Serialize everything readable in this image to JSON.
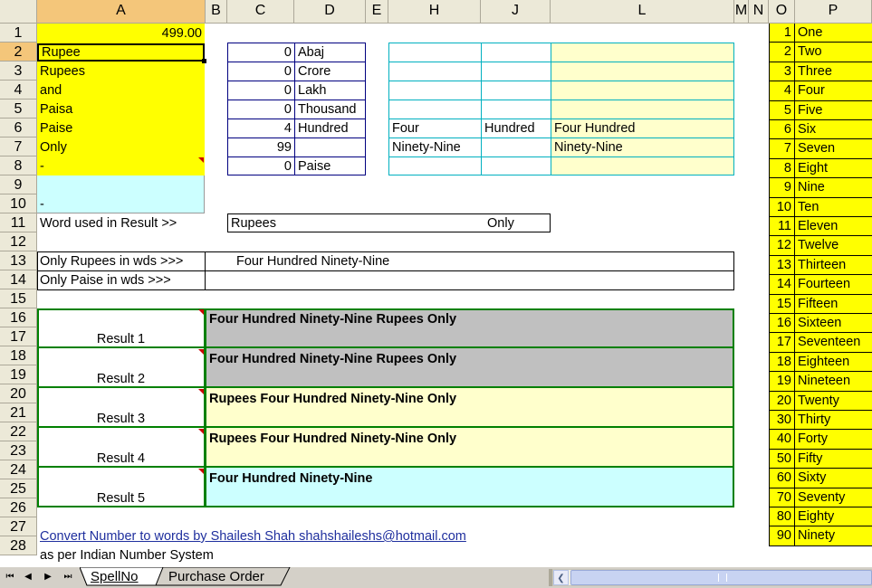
{
  "columns": [
    "A",
    "B",
    "C",
    "D",
    "E",
    "H",
    "J",
    "L",
    "M",
    "N",
    "O",
    "P"
  ],
  "rows": [
    "1",
    "2",
    "3",
    "4",
    "5",
    "6",
    "7",
    "8",
    "9",
    "10",
    "11",
    "12",
    "13",
    "14",
    "15",
    "16",
    "17",
    "18",
    "19",
    "20",
    "21",
    "22",
    "23",
    "24",
    "25",
    "26",
    "27",
    "28"
  ],
  "colA": {
    "a1": "499.00",
    "a2": "Rupee",
    "a3": "Rupees",
    "a4": "and",
    "a5": "Paisa",
    "a6": "Paise",
    "a7": "Only",
    "a8": "-",
    "a10": "-"
  },
  "place_values": [
    {
      "num": "0",
      "label": "Abaj"
    },
    {
      "num": "0",
      "label": "Crore"
    },
    {
      "num": "0",
      "label": "Lakh"
    },
    {
      "num": "0",
      "label": "Thousand"
    },
    {
      "num": "4",
      "label": "Hundred"
    },
    {
      "num": "99",
      "label": ""
    },
    {
      "num": "0",
      "label": "Paise"
    }
  ],
  "words_table": [
    {
      "h": "",
      "j": "",
      "l": ""
    },
    {
      "h": "",
      "j": "",
      "l": ""
    },
    {
      "h": "",
      "j": "",
      "l": ""
    },
    {
      "h": "",
      "j": "",
      "l": ""
    },
    {
      "h": "Four",
      "j": "Hundred",
      "l": "Four Hundred"
    },
    {
      "h": "Ninety-Nine",
      "j": "",
      "l": "Ninety-Nine"
    },
    {
      "h": "",
      "j": "",
      "l": ""
    }
  ],
  "word_used": {
    "label": "Word used in Result >>",
    "prefix": "Rupees",
    "suffix": "Only"
  },
  "only_rupees": {
    "label": "Only Rupees in wds  >>>",
    "value": "Four Hundred Ninety-Nine"
  },
  "only_paise": {
    "label": "Only Paise in wds   >>>",
    "value": ""
  },
  "results": [
    {
      "label": "Result 1",
      "value": "Four Hundred Ninety-Nine Rupees Only"
    },
    {
      "label": "Result 2",
      "value": "Four Hundred Ninety-Nine Rupees Only"
    },
    {
      "label": "Result 3",
      "value": "Rupees Four Hundred Ninety-Nine Only"
    },
    {
      "label": "Result 4",
      "value": "Rupees Four Hundred Ninety-Nine Only"
    },
    {
      "label": "Result 5",
      "value": "Four Hundred Ninety-Nine"
    }
  ],
  "footer": {
    "link": "Convert Number to words by Shailesh Shah shahshaileshs@hotmail.com",
    "note": "as per Indian Number System"
  },
  "lookup": [
    {
      "n": "1",
      "w": "One"
    },
    {
      "n": "2",
      "w": "Two"
    },
    {
      "n": "3",
      "w": "Three"
    },
    {
      "n": "4",
      "w": "Four"
    },
    {
      "n": "5",
      "w": "Five"
    },
    {
      "n": "6",
      "w": "Six"
    },
    {
      "n": "7",
      "w": "Seven"
    },
    {
      "n": "8",
      "w": "Eight"
    },
    {
      "n": "9",
      "w": "Nine"
    },
    {
      "n": "10",
      "w": "Ten"
    },
    {
      "n": "11",
      "w": "Eleven"
    },
    {
      "n": "12",
      "w": "Twelve"
    },
    {
      "n": "13",
      "w": "Thirteen"
    },
    {
      "n": "14",
      "w": "Fourteen"
    },
    {
      "n": "15",
      "w": "Fifteen"
    },
    {
      "n": "16",
      "w": "Sixteen"
    },
    {
      "n": "17",
      "w": "Seventeen"
    },
    {
      "n": "18",
      "w": "Eighteen"
    },
    {
      "n": "19",
      "w": "Nineteen"
    },
    {
      "n": "20",
      "w": "Twenty"
    },
    {
      "n": "30",
      "w": "Thirty"
    },
    {
      "n": "40",
      "w": "Forty"
    },
    {
      "n": "50",
      "w": "Fifty"
    },
    {
      "n": "60",
      "w": "Sixty"
    },
    {
      "n": "70",
      "w": "Seventy"
    },
    {
      "n": "80",
      "w": "Eighty"
    },
    {
      "n": "90",
      "w": "Ninety"
    }
  ],
  "tabs": {
    "active": "SpellNo",
    "other": "Purchase Order"
  },
  "colors": {
    "yellow": "#ffff00",
    "cyan": "#ccffff",
    "light_yellow": "#ffffcc",
    "gray": "#c0c0c0",
    "green_border": "#008000"
  }
}
